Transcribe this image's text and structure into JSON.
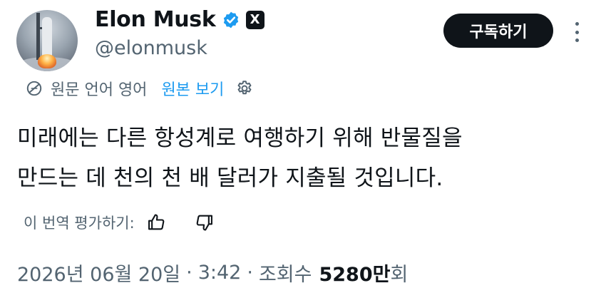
{
  "profile": {
    "name": "Elon Musk",
    "handle": "@elonmusk",
    "verified_icon": "verified-badge-icon",
    "affiliate_badge": "X",
    "avatar_description_icon": "rocket-launch-avatar"
  },
  "actions": {
    "subscribe_label": "구독하기",
    "more_icon": "more-vertical-icon"
  },
  "translation": {
    "icon": "globe-translate-icon",
    "status": "원문 언어 영어",
    "view_original": "원본 보기",
    "settings_icon": "gear-icon"
  },
  "tweet": {
    "line1": "미래에는 다른 항성계로 여행하기 위해 반물질을",
    "line2": "만드는 데 천의 천 배 달러가 지출될 것입니다."
  },
  "rate": {
    "label": "이 번역 평가하기:",
    "thumbs_up_icon": "thumbs-up-icon",
    "thumbs_down_icon": "thumbs-down-icon"
  },
  "meta": {
    "date": "2026년 06월 20일",
    "time": "3:42",
    "views_label": "조회수",
    "views_number": "5280",
    "views_unit": "만",
    "views_suffix": "회"
  },
  "colors": {
    "text_primary": "#0f1419",
    "text_secondary": "#536471",
    "link": "#1d9bf0",
    "verified": "#1d9bf0",
    "button_bg": "#0f1419"
  }
}
